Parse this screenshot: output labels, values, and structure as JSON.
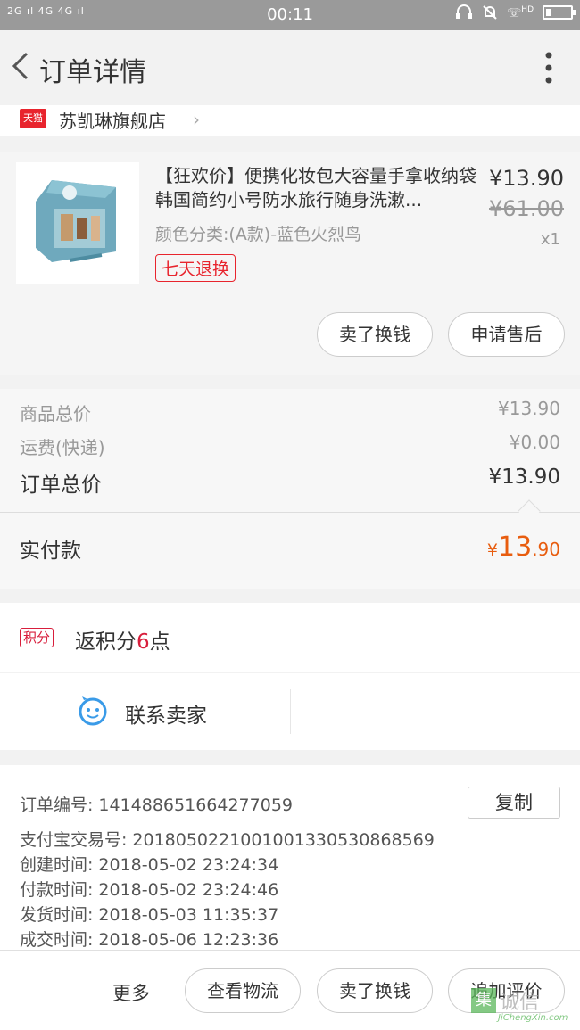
{
  "status_bar": {
    "signal_left": "2G ıl 4G 4G ıl",
    "time": "00:11",
    "right_icons": [
      "headset-icon",
      "mute-icon",
      "hd-call-icon",
      "battery-icon"
    ],
    "hd_label": "HD"
  },
  "nav": {
    "title": "订单详情"
  },
  "shop": {
    "badge": "天猫",
    "name": "苏凯琳旗舰店"
  },
  "item": {
    "title": "【狂欢价】便携化妆包大容量手拿收纳袋韩国简约小号防水旅行随身洗漱...",
    "spec": "颜色分类:(A款)-蓝色火烈鸟",
    "tag": "七天退换",
    "price_now": "¥13.90",
    "price_old": "¥61.00",
    "qty": "x1",
    "actions": {
      "sell": "卖了换钱",
      "after_sales": "申请售后"
    }
  },
  "summary": {
    "goods_label": "商品总价",
    "goods_value": "¥13.90",
    "freight_label": "运费(快递)",
    "freight_value": "¥0.00",
    "total_label": "订单总价",
    "total_value": "¥13.90",
    "paid_label": "实付款",
    "paid_currency": "¥",
    "paid_int": "13",
    "paid_dec": ".90"
  },
  "points": {
    "badge": "积分",
    "prefix": "返积分",
    "number": "6",
    "suffix": "点"
  },
  "contact": {
    "label": "联系卖家"
  },
  "details": {
    "order_no_label": "订单编号:",
    "order_no": "141488651664277059",
    "copy_label": "复制",
    "alipay_label": "支付宝交易号:",
    "alipay_no": "2018050221001001330530868569",
    "created_label": "创建时间:",
    "created": "2018-05-02 23:24:34",
    "paid_label": "付款时间:",
    "paid": "2018-05-02 23:24:46",
    "shipped_label": "发货时间:",
    "shipped": "2018-05-03 11:35:37",
    "closed_label": "成交时间:",
    "closed": "2018-05-06 12:23:36"
  },
  "bottom": {
    "more": "更多",
    "logistics": "查看物流",
    "sell": "卖了换钱",
    "review": "追加评价"
  },
  "watermark": {
    "box": "集",
    "text": "诚信",
    "sub": "JiChengXin.com"
  },
  "colors": {
    "accent_red": "#e8242d",
    "price_orange": "#e85d0f",
    "contact_blue": "#3a9be8"
  }
}
